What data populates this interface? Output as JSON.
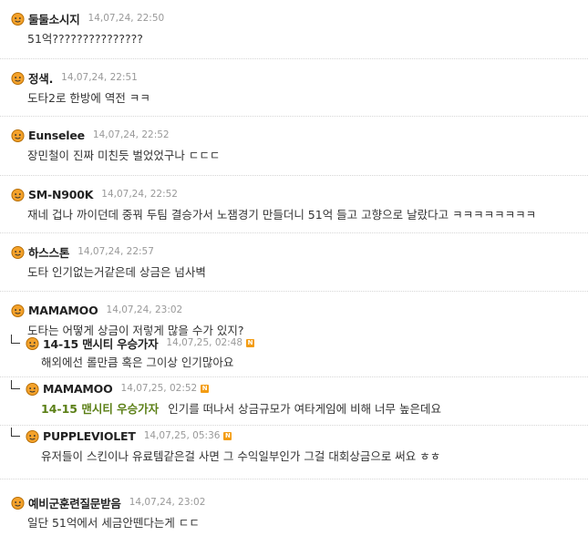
{
  "comments": [
    {
      "nick": "둘둘소시지",
      "date": "14,07,24, 22:50",
      "text": "51억???????????????"
    },
    {
      "nick": "정색.",
      "date": "14,07,24, 22:51",
      "text": "도타2로 한방에 역전 ㅋㅋ"
    },
    {
      "nick": "Eunselee",
      "date": "14,07,24, 22:52",
      "text": "장민철이 진짜 미친듯 벌었었구나 ㄷㄷㄷ"
    },
    {
      "nick": "SM-N900K",
      "date": "14,07,24, 22:52",
      "text": "재네 겁나 까이던데 중꿔 두팀 결승가서 노잼경기 만들더니 51억 들고 고향으로 날랐다고 ㅋㅋㅋㅋㅋㅋㅋㅋ"
    },
    {
      "nick": "하스스톤",
      "date": "14,07,24, 22:57",
      "text": "도타 인기없는거같은데 상금은 넘사벽"
    },
    {
      "nick": "MAMAMOO",
      "date": "14,07,24, 23:02",
      "text": "도타는 어떻게 상금이 저렇게 많을 수가 있지?"
    },
    {
      "nick": "14-15 맨시티 우승가자",
      "date": "14,07,25, 02:48",
      "text": "해외에선 롤만큼 혹은 그이상 인기많아요",
      "new": "N"
    },
    {
      "nick": "MAMAMOO",
      "date": "14,07,25, 02:52",
      "mention": "14-15 맨시티 우승가자",
      "text": "인기를 떠나서 상금규모가 여타게임에 비해 너무 높은데요",
      "new": "N"
    },
    {
      "nick": "PUPPLEVIOLET",
      "date": "14,07,25, 05:36",
      "text": "유저들이 스킨이나 유료템같은걸 사면 그 수익일부인가 그걸 대회상금으로 써요 ㅎㅎ",
      "new": "N"
    },
    {
      "nick": "예비군훈련질문받음",
      "date": "14,07,24, 23:02",
      "text": "일단 51억에서 세금안뗀다는게 ㄷㄷ"
    }
  ]
}
